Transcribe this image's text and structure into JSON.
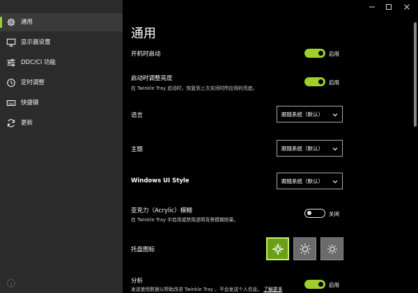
{
  "sidebar": {
    "items": [
      {
        "label": "通用",
        "icon": "gear-icon",
        "active": true
      },
      {
        "label": "显示器设置",
        "icon": "monitor-icon",
        "active": false
      },
      {
        "label": "DDC/CI 功能",
        "icon": "sliders-icon",
        "active": false
      },
      {
        "label": "定时调整",
        "icon": "clock-icon",
        "active": false
      },
      {
        "label": "快捷键",
        "icon": "keyboard-icon",
        "active": false
      },
      {
        "label": "更新",
        "icon": "refresh-icon",
        "active": false
      }
    ]
  },
  "window": {
    "minimize_icon": "minimize-icon",
    "maximize_icon": "maximize-icon",
    "close_icon": "close-icon"
  },
  "main": {
    "title": "通用",
    "settings": {
      "startup": {
        "label": "开机时启动",
        "state": "启用",
        "on": true
      },
      "brightness_on_start": {
        "label": "启动时调整亮度",
        "desc": "在 Twinkle Tray 启动时，恢复到上次关闭时所应用的亮度。",
        "state": "启用",
        "on": true
      },
      "language": {
        "label": "语言",
        "value": "跟随系统（默认）"
      },
      "theme": {
        "label": "主题",
        "value": "跟随系统（默认）"
      },
      "windows_ui_style": {
        "label": "Windows UI Style",
        "value": "跟随系统（默认）"
      },
      "acrylic": {
        "label": "亚克力（Acrylic）模糊",
        "desc": "在 Twinkle Tray 中启用或禁用透明背景模糊效果。",
        "state": "关闭",
        "on": false
      },
      "tray_icon": {
        "label": "托盘图标",
        "selected_index": 0
      },
      "analytics": {
        "label": "分析",
        "desc": "发送使用数据以帮助改进 Twinkle Tray 。不会发送个人信息。",
        "link": "了解更多",
        "state": "启用",
        "on": true
      }
    }
  },
  "colors": {
    "accent": "#9fcf2a",
    "sidebar_bg": "#2b2b2b",
    "main_bg": "#000000"
  }
}
